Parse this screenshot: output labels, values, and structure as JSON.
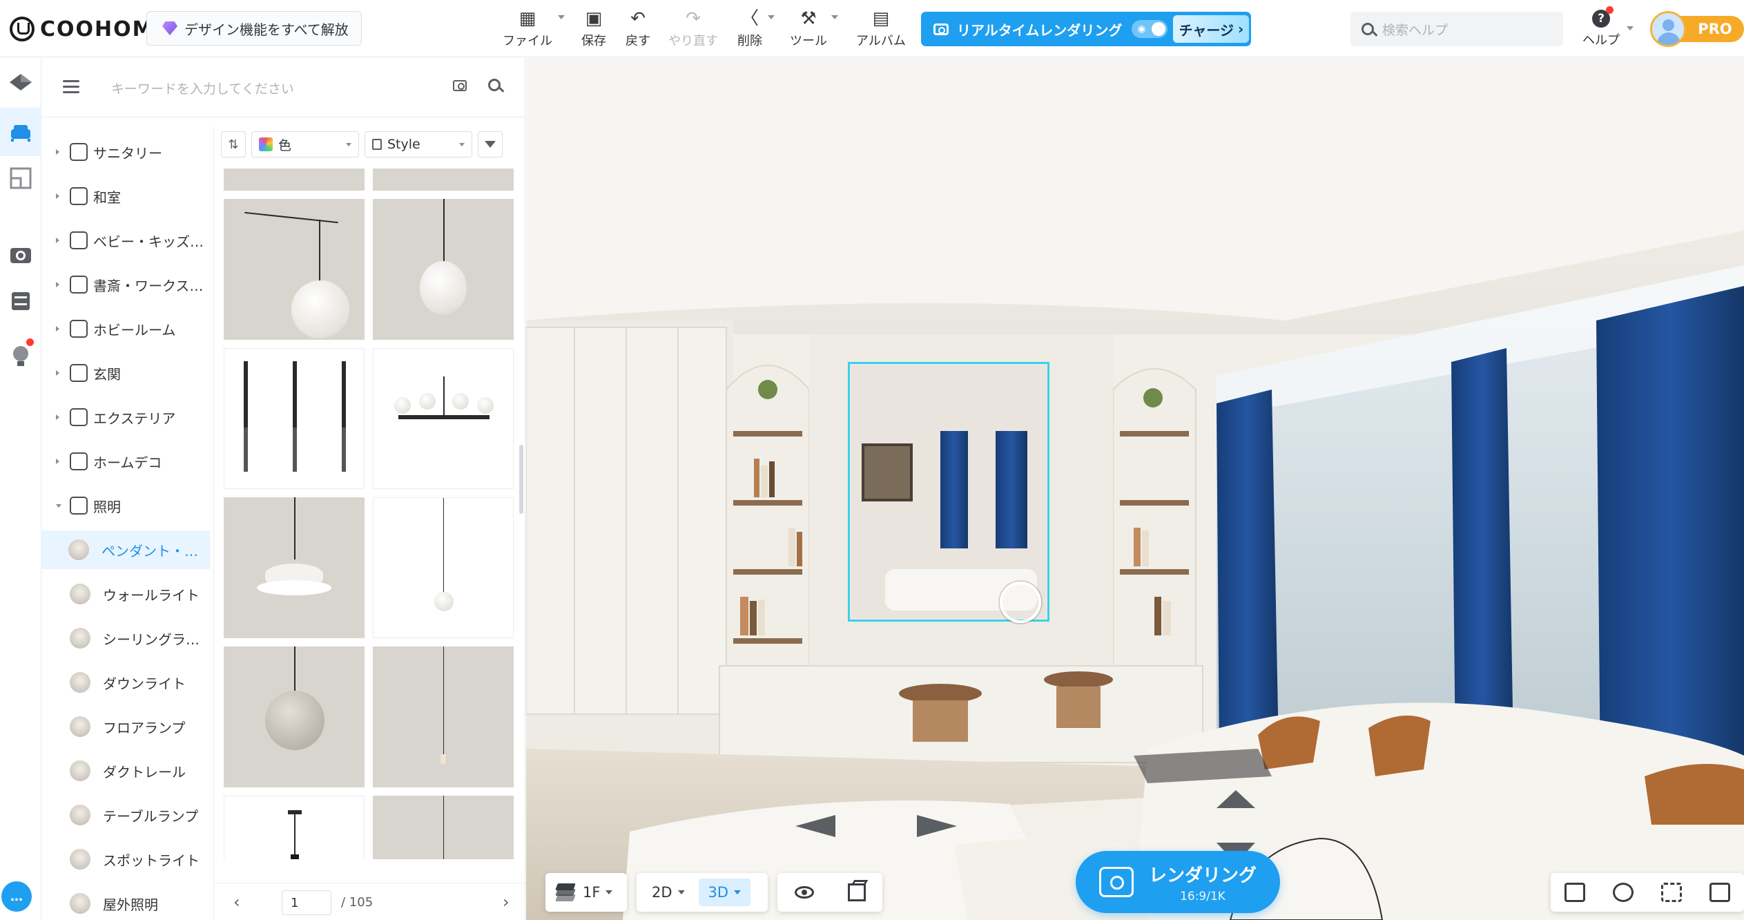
{
  "app": {
    "logo_text": "COOHOM",
    "unlock_label": "デザイン機能をすべて解放"
  },
  "toolbar": {
    "file": "ファイル",
    "save": "保存",
    "undo": "戻す",
    "redo": "やり直す",
    "delete": "削除",
    "tools": "ツール",
    "album": "アルバム"
  },
  "realtime": {
    "label": "リアルタイムレンダリング",
    "charge_label": "チャージ"
  },
  "search_help": {
    "placeholder": "検索ヘルプ"
  },
  "help": {
    "label": "ヘルプ"
  },
  "user": {
    "badge": "PRO"
  },
  "panel": {
    "search_placeholder": "キーワードを入力してください",
    "categories": [
      "サニタリー",
      "和室",
      "ベビー・キッズ…",
      "書斎・ワークス…",
      "ホビールーム",
      "玄関",
      "エクステリア",
      "ホームデコ",
      "照明"
    ],
    "subcategories": [
      "ペンダント・シ…",
      "ウォールライト",
      "シーリングライト",
      "ダウンライト",
      "フロアランプ",
      "ダクトレール",
      "テーブルランプ",
      "スポットライト",
      "屋外照明"
    ],
    "filters": {
      "color": "色",
      "style": "Style"
    },
    "pager": {
      "current": "1",
      "total": "/ 105"
    }
  },
  "viewport": {
    "floor": "1F",
    "mode_2d": "2D",
    "mode_3d": "3D",
    "render_label": "レンダリング",
    "render_spec": "16:9/1K"
  },
  "colors": {
    "accent": "#1f9ff0",
    "selection": "#3ad0ea",
    "pro": "#f7a928",
    "curtain": "#1d4e93"
  }
}
